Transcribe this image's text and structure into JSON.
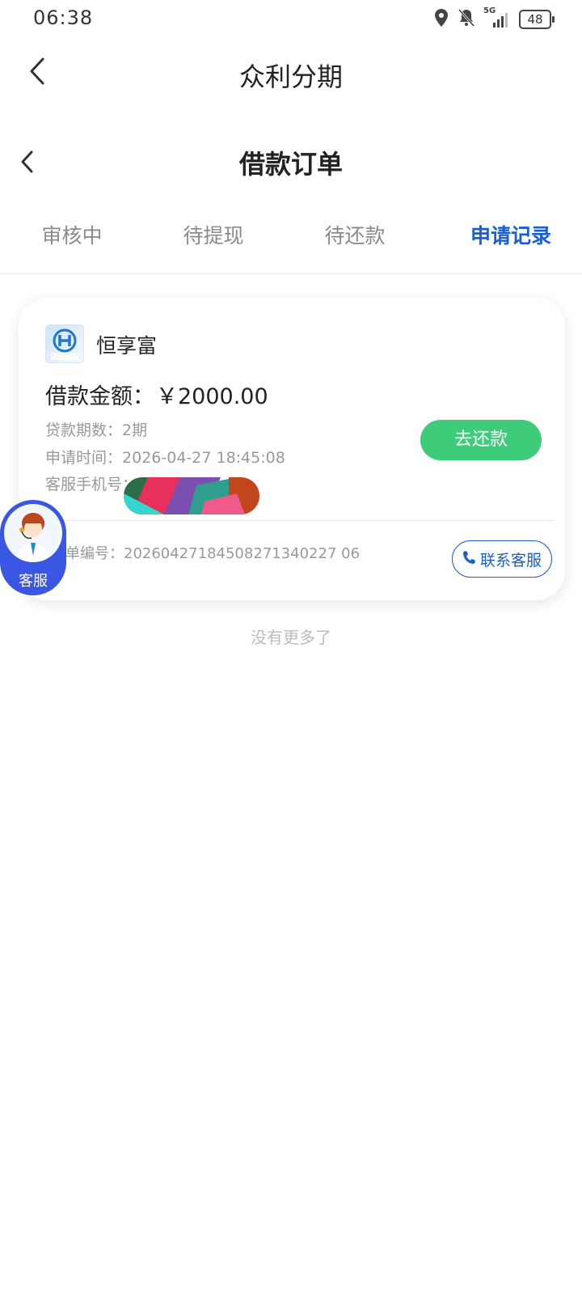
{
  "status_bar": {
    "time": "06:38",
    "network": "5G",
    "battery": "48"
  },
  "app": {
    "title": "众利分期"
  },
  "page": {
    "title": "借款订单"
  },
  "tabs": [
    {
      "label": "审核中"
    },
    {
      "label": "待提现"
    },
    {
      "label": "待还款"
    },
    {
      "label": "申请记录",
      "active": true
    }
  ],
  "order": {
    "brand": "恒享富",
    "brand_logo_text": "恒享富",
    "amount_label": "借款金额：",
    "amount": "￥2000.00",
    "term_label": "贷款期数：",
    "term_value": "2期",
    "time_label": "申请时间：",
    "time_value": "2026-04-27 18:45:08",
    "phone_label": "客服手机号：",
    "phone_value_prefix": "1",
    "repay_button": "去还款",
    "order_no_label": "单编号：",
    "order_no": "20260427184508271340227 06",
    "contact_button": "联系客服"
  },
  "float_service": {
    "label": "客服"
  },
  "footer": {
    "no_more": "没有更多了"
  },
  "colors": {
    "accent": "#1a5fd0",
    "repay_green": "#3fcc7a",
    "float_blue": "#3a57e3"
  }
}
